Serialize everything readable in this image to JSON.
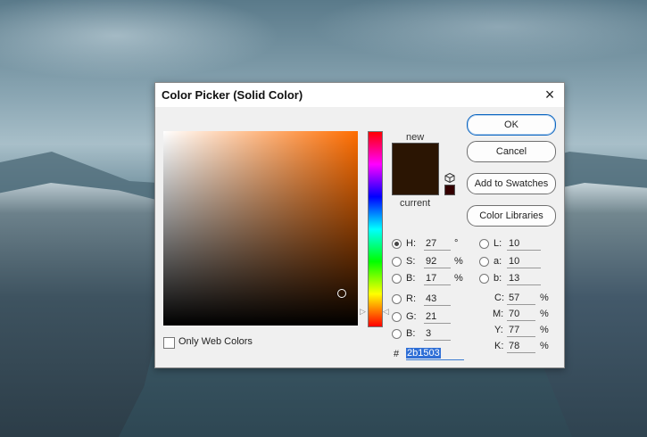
{
  "dialog": {
    "title": "Color Picker (Solid Color)",
    "close_icon": "×"
  },
  "colors": {
    "new": "#2b1503",
    "current": "#2b1503",
    "accent": "#2f6fd6"
  },
  "swatch_labels": {
    "new": "new",
    "current": "current"
  },
  "buttons": {
    "ok": "OK",
    "cancel": "Cancel",
    "add_to_swatches": "Add to Swatches",
    "color_libraries": "Color Libraries"
  },
  "hsb": {
    "h": {
      "label": "H:",
      "value": "27",
      "unit": "°"
    },
    "s": {
      "label": "S:",
      "value": "92",
      "unit": "%"
    },
    "b": {
      "label": "B:",
      "value": "17",
      "unit": "%"
    }
  },
  "rgb": {
    "r": {
      "label": "R:",
      "value": "43"
    },
    "g": {
      "label": "G:",
      "value": "21"
    },
    "b": {
      "label": "B:",
      "value": "3"
    }
  },
  "lab": {
    "l": {
      "label": "L:",
      "value": "10"
    },
    "a": {
      "label": "a:",
      "value": "10"
    },
    "b": {
      "label": "b:",
      "value": "13"
    }
  },
  "cmyk": {
    "c": {
      "label": "C:",
      "value": "57",
      "unit": "%"
    },
    "m": {
      "label": "M:",
      "value": "70",
      "unit": "%"
    },
    "y": {
      "label": "Y:",
      "value": "77",
      "unit": "%"
    },
    "k": {
      "label": "K:",
      "value": "78",
      "unit": "%"
    }
  },
  "hex": {
    "hash": "#",
    "value": "2b1503"
  },
  "only_web_colors": "Only Web Colors",
  "icons": {
    "cube": "cube-icon",
    "hue_arrow": "◁"
  }
}
